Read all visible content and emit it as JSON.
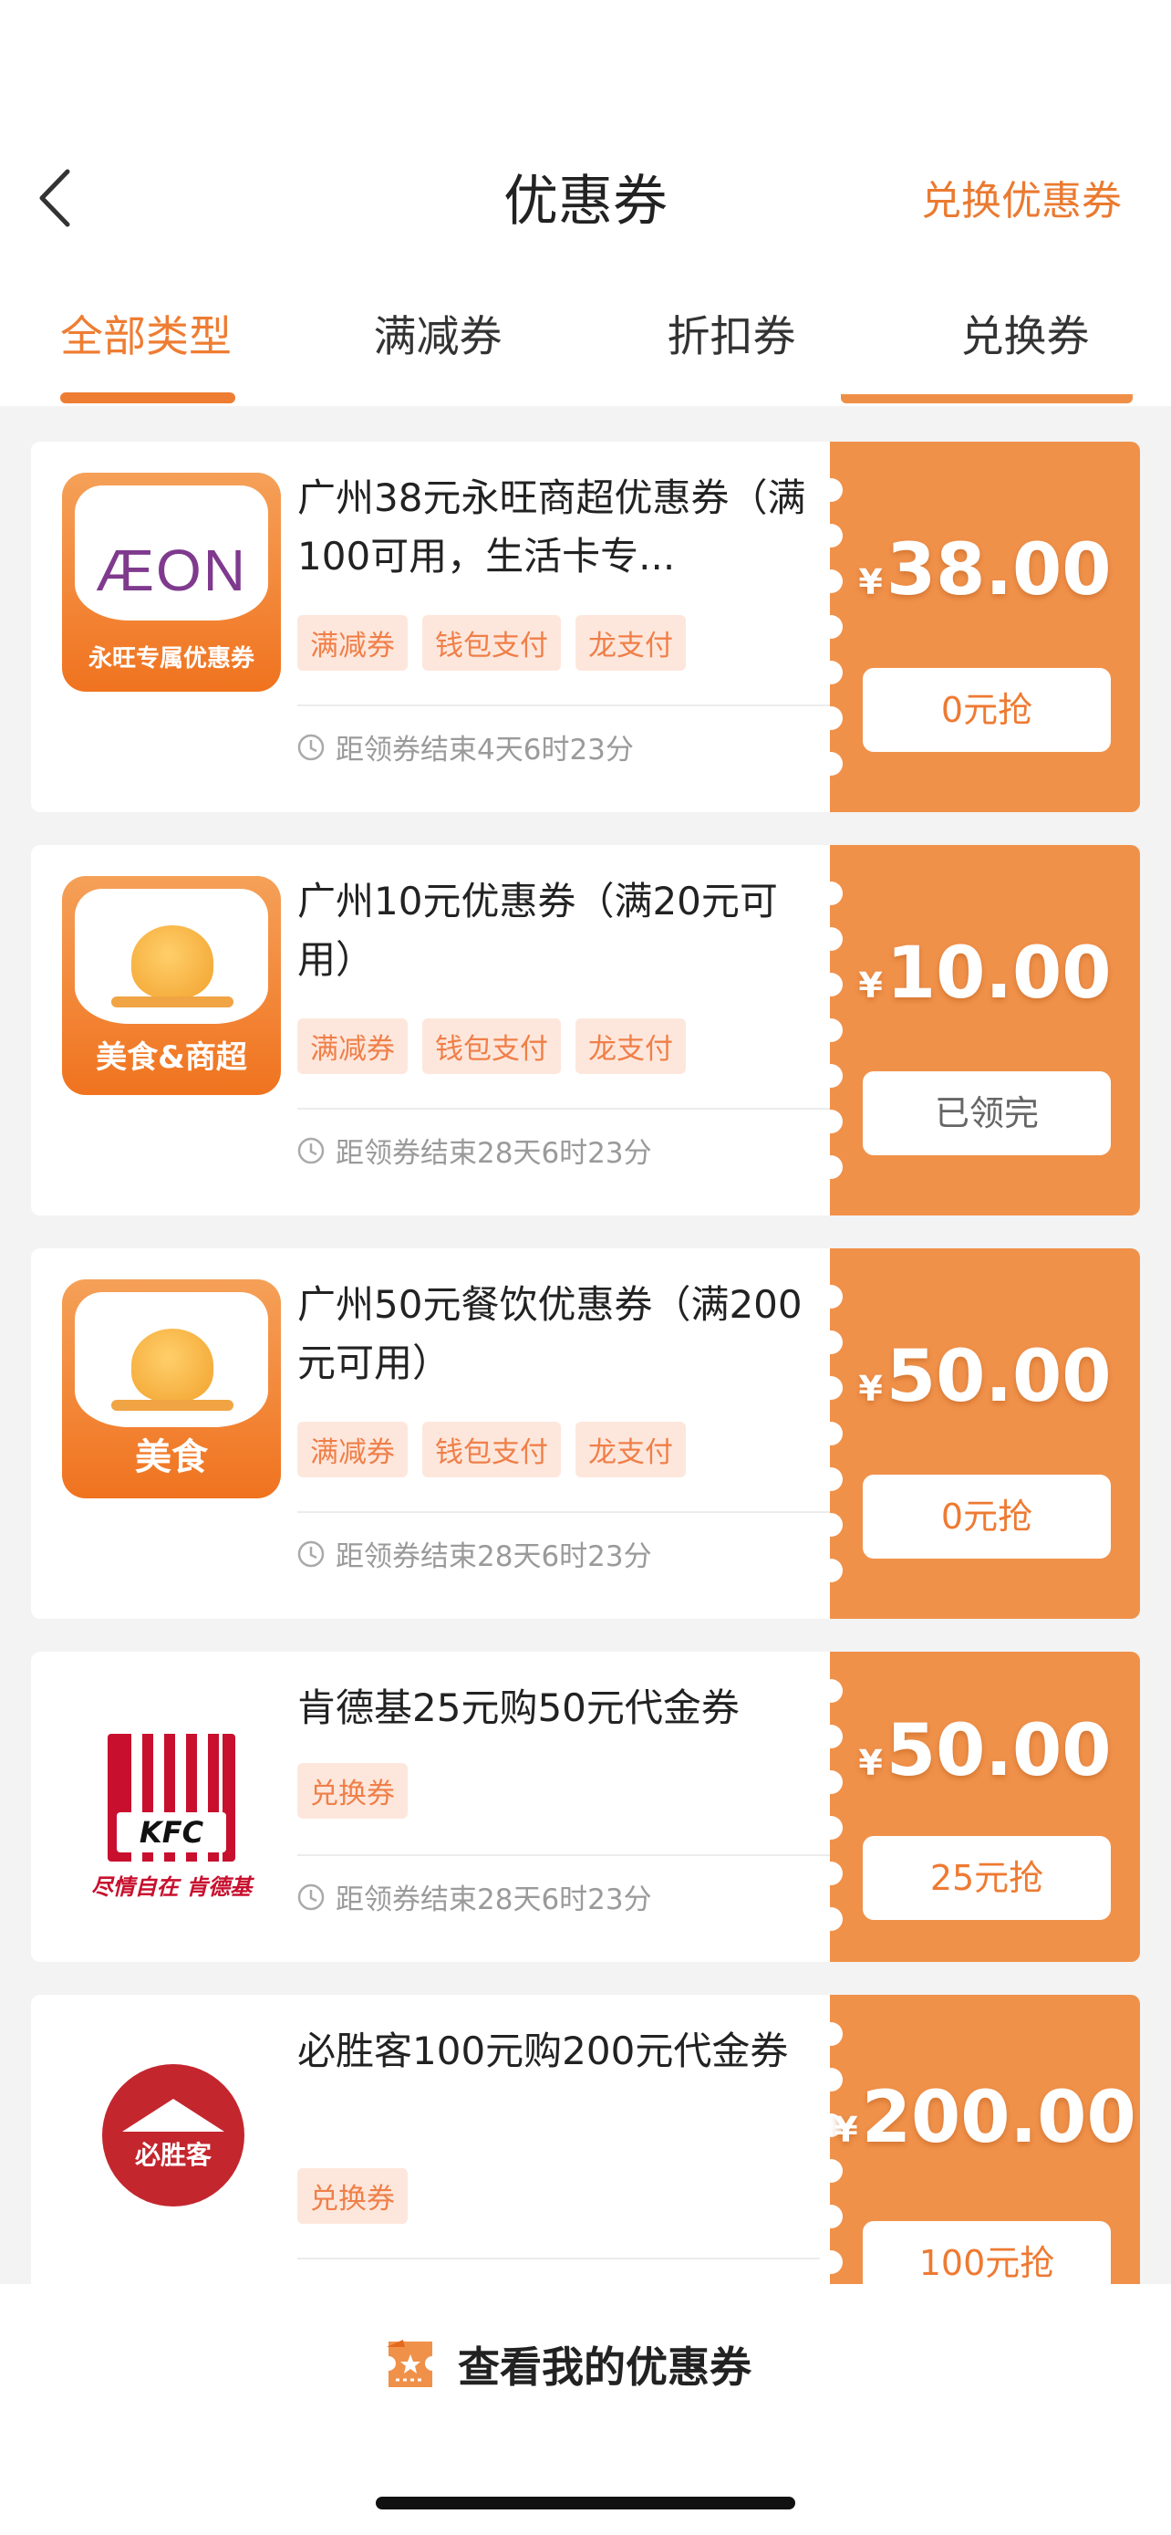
{
  "header": {
    "title": "优惠券",
    "redeem_link": "兑换优惠券"
  },
  "tabs": [
    {
      "label": "全部类型",
      "active": true
    },
    {
      "label": "满减券",
      "active": false
    },
    {
      "label": "折扣券",
      "active": false
    },
    {
      "label": "兑换券",
      "active": false
    }
  ],
  "coupons": [
    {
      "title": "广州38元永旺商超优惠券（满100可用，生活卡专...",
      "logo_text": "ÆON",
      "logo_caption": "永旺专属优惠券",
      "badges": [
        "满减券",
        "钱包支付",
        "龙支付"
      ],
      "time": "距领券结束4天6时23分",
      "price_symbol": "¥",
      "price": "38.00",
      "button": "0元抢"
    },
    {
      "title": "广州10元优惠券（满20元可用）",
      "logo_caption": "美食&商超",
      "badges": [
        "满减券",
        "钱包支付",
        "龙支付"
      ],
      "time": "距领券结束28天6时23分",
      "price_symbol": "¥",
      "price": "10.00",
      "button": "已领完"
    },
    {
      "title": "广州50元餐饮优惠券（满200元可用）",
      "logo_caption": "美食",
      "badges": [
        "满减券",
        "钱包支付",
        "龙支付"
      ],
      "time": "距领券结束28天6时23分",
      "price_symbol": "¥",
      "price": "50.00",
      "button": "0元抢"
    },
    {
      "title": "肯德基25元购50元代金券",
      "logo_text": "KFC",
      "logo_caption": "尽情自在 肯德基",
      "badges": [
        "兑换券"
      ],
      "time": "距领券结束28天6时23分",
      "price_symbol": "¥",
      "price": "50.00",
      "button": "25元抢"
    },
    {
      "title": "必胜客100元购200元代金券",
      "logo_text": "必胜客",
      "badges": [
        "兑换券"
      ],
      "price_symbol": "¥",
      "price": "200.00",
      "button": "100元抢"
    }
  ],
  "footer": {
    "button_label": "查看我的优惠券"
  },
  "colors": {
    "accent": "#ee7d33",
    "stub": "#f0914a",
    "badge_bg": "#fde7dc",
    "badge_text": "#f07f49",
    "kfc_red": "#c8102e",
    "pizza_red": "#c4262e"
  }
}
